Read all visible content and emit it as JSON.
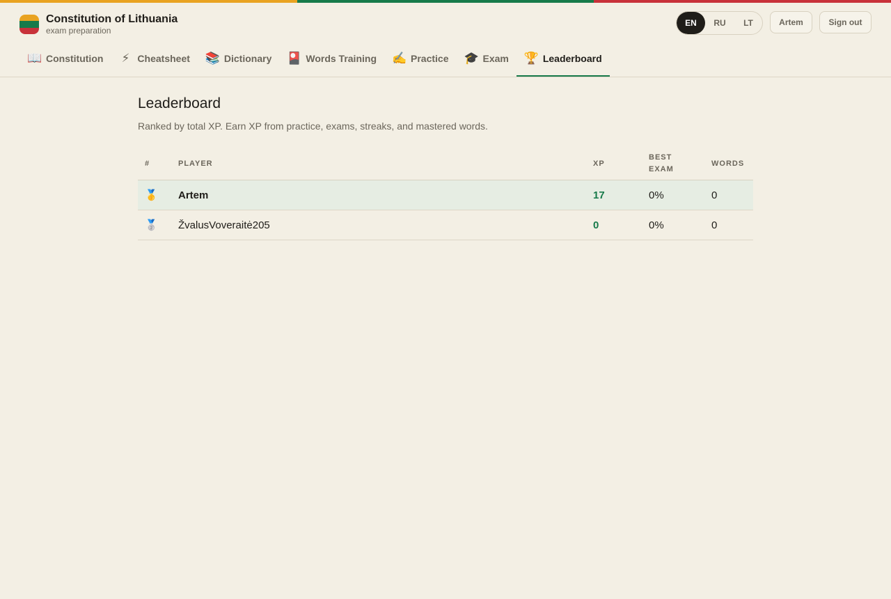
{
  "app": {
    "title": "Constitution of Lithuania",
    "subtitle": "exam preparation",
    "flag_colors": [
      "#e9a321",
      "#177a4a",
      "#c8323a"
    ]
  },
  "languages": {
    "items": [
      "EN",
      "RU",
      "LT"
    ],
    "selected": "EN"
  },
  "user": {
    "name": "Artem",
    "sign_out_label": "Sign out"
  },
  "nav": {
    "tabs": [
      {
        "icon": "📖",
        "icon_name": "book-icon",
        "label": "Constitution"
      },
      {
        "icon": "⚡",
        "icon_name": "lightning-icon",
        "label": "Cheatsheet"
      },
      {
        "icon": "📚",
        "icon_name": "books-icon",
        "label": "Dictionary"
      },
      {
        "icon": "🎴",
        "icon_name": "flashcard-icon",
        "label": "Words Training"
      },
      {
        "icon": "✍️",
        "icon_name": "writing-hand-icon",
        "label": "Practice"
      },
      {
        "icon": "🎓",
        "icon_name": "graduation-cap-icon",
        "label": "Exam"
      },
      {
        "icon": "🏆",
        "icon_name": "trophy-icon",
        "label": "Leaderboard"
      }
    ],
    "active": "Leaderboard"
  },
  "page": {
    "title": "Leaderboard",
    "subtitle": "Ranked by total XP. Earn XP from practice, exams, streaks, and mastered words."
  },
  "leaderboard": {
    "columns": [
      "#",
      "PLAYER",
      "XP",
      "BEST EXAM",
      "WORDS"
    ],
    "rows": [
      {
        "rank_icon": "🥇",
        "rank_icon_name": "gold-medal-icon",
        "player": "Artem",
        "xp": "17",
        "best_exam": "0%",
        "words": "0",
        "is_current_user": true
      },
      {
        "rank_icon": "🥈",
        "rank_icon_name": "silver-medal-icon",
        "player": "ŽvalusVoveraitė205",
        "xp": "0",
        "best_exam": "0%",
        "words": "0",
        "is_current_user": false
      }
    ]
  }
}
